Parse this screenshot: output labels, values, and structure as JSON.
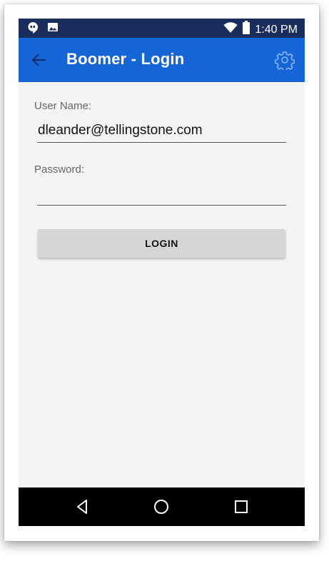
{
  "status_bar": {
    "time": "1:40 PM",
    "left_icons": [
      "hangouts-icon",
      "image-icon"
    ],
    "right_icons": [
      "wifi-icon",
      "battery-icon"
    ]
  },
  "app_bar": {
    "title": "Boomer - Login",
    "back_icon": "arrow-left-icon",
    "settings_icon": "gear-icon",
    "color": "#1565d6"
  },
  "form": {
    "username_label": "User Name:",
    "username_value": "dleander@tellingstone.com",
    "password_label": "Password:",
    "password_value": "",
    "login_label": "LOGIN"
  },
  "nav_bar": {
    "buttons": [
      "back-triangle-icon",
      "home-circle-icon",
      "recents-square-icon"
    ]
  },
  "colors": {
    "status_bar": "#1a2d5c",
    "app_bar": "#1565d6",
    "background": "#f4f4f4",
    "button": "#d6d6d6"
  }
}
